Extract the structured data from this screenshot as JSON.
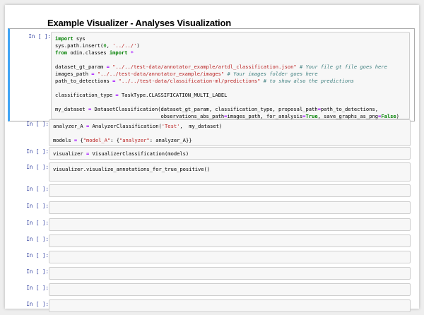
{
  "notebook": {
    "title": "Example Visualizer - Analyses Visualization",
    "prompt_label": "In [ ]:"
  },
  "cells": [
    {
      "lines": [
        [
          {
            "t": "kw",
            "v": "import"
          },
          {
            "t": "",
            "v": " sys"
          }
        ],
        [
          {
            "t": "",
            "v": "sys.path.insert("
          },
          {
            "t": "num",
            "v": "0"
          },
          {
            "t": "",
            "v": ", "
          },
          {
            "t": "str",
            "v": "'../../'"
          },
          {
            "t": "",
            "v": ")"
          }
        ],
        [
          {
            "t": "kw",
            "v": "from"
          },
          {
            "t": "",
            "v": " odin.classes "
          },
          {
            "t": "kw",
            "v": "import"
          },
          {
            "t": "",
            "v": " "
          },
          {
            "t": "op",
            "v": "*"
          }
        ],
        [],
        [
          {
            "t": "",
            "v": "dataset_gt_param "
          },
          {
            "t": "op",
            "v": "="
          },
          {
            "t": "",
            "v": " "
          },
          {
            "t": "str",
            "v": "\"../../test-data/annotator_example/artdl_classification.json\""
          },
          {
            "t": "",
            "v": " "
          },
          {
            "t": "cm",
            "v": "# Your file gt file goes here"
          }
        ],
        [
          {
            "t": "",
            "v": "images_path "
          },
          {
            "t": "op",
            "v": "="
          },
          {
            "t": "",
            "v": " "
          },
          {
            "t": "str",
            "v": "\"../../test-data/annotator_example/images\""
          },
          {
            "t": "",
            "v": " "
          },
          {
            "t": "cm",
            "v": "# Your images folder goes here"
          }
        ],
        [
          {
            "t": "",
            "v": "path_to_detections "
          },
          {
            "t": "op",
            "v": "="
          },
          {
            "t": "",
            "v": " "
          },
          {
            "t": "str",
            "v": "\"../../test-data/classification-ml/predictions\""
          },
          {
            "t": "",
            "v": " "
          },
          {
            "t": "cm",
            "v": "# to show also the predictions"
          }
        ],
        [],
        [
          {
            "t": "",
            "v": "classification_type "
          },
          {
            "t": "op",
            "v": "="
          },
          {
            "t": "",
            "v": " TaskType.CLASSIFICATION_MULTI_LABEL"
          }
        ],
        [],
        [
          {
            "t": "",
            "v": "my_dataset "
          },
          {
            "t": "op",
            "v": "="
          },
          {
            "t": "",
            "v": " DatasetClassification(dataset_gt_param, classification_type, proposal_path"
          },
          {
            "t": "op",
            "v": "="
          },
          {
            "t": "",
            "v": "path_to_detections,"
          }
        ],
        [
          {
            "t": "",
            "v": "                                   observations_abs_path"
          },
          {
            "t": "op",
            "v": "="
          },
          {
            "t": "",
            "v": "images_path, for_analysis"
          },
          {
            "t": "op",
            "v": "="
          },
          {
            "t": "bool",
            "v": "True"
          },
          {
            "t": "",
            "v": ", save_graphs_as_png"
          },
          {
            "t": "op",
            "v": "="
          },
          {
            "t": "bool",
            "v": "False"
          },
          {
            "t": "",
            "v": ")"
          }
        ]
      ]
    },
    {
      "lines": [
        [
          {
            "t": "",
            "v": "analyzer_A "
          },
          {
            "t": "op",
            "v": "="
          },
          {
            "t": "",
            "v": " AnalyzerClassification("
          },
          {
            "t": "str",
            "v": "'Test'"
          },
          {
            "t": "",
            "v": ",  my_dataset)"
          }
        ],
        [],
        [
          {
            "t": "",
            "v": "models "
          },
          {
            "t": "op",
            "v": "="
          },
          {
            "t": "",
            "v": " {"
          },
          {
            "t": "str",
            "v": "\"model_A\""
          },
          {
            "t": "",
            "v": ": {"
          },
          {
            "t": "str",
            "v": "\"analyzer\""
          },
          {
            "t": "",
            "v": ": analyzer_A}}"
          }
        ]
      ]
    },
    {
      "lines": [
        [
          {
            "t": "",
            "v": "visualizer "
          },
          {
            "t": "op",
            "v": "="
          },
          {
            "t": "",
            "v": " VisualizerClassification(models)"
          }
        ]
      ]
    },
    {
      "lines": [
        [
          {
            "t": "",
            "v": "visualizer.visualize_annotations_for_true_positive()"
          }
        ]
      ]
    },
    {
      "lines": []
    },
    {
      "lines": []
    },
    {
      "lines": []
    },
    {
      "lines": []
    },
    {
      "lines": []
    },
    {
      "lines": []
    },
    {
      "lines": []
    },
    {
      "lines": []
    }
  ]
}
